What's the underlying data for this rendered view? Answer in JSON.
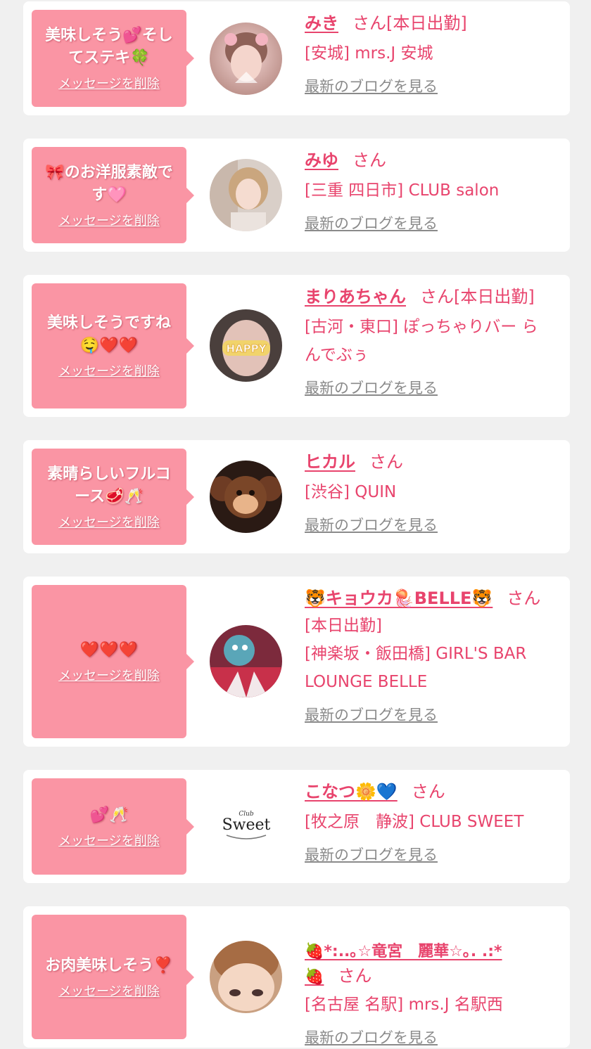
{
  "delete_label": "メッセージを削除",
  "blog_label": "最新のブログを見る",
  "cards": [
    {
      "message": "美味しそう💕そし\nてステキ🍀",
      "name": "みき",
      "suffix": "さん[本日出勤]",
      "shop_lines": [
        "[安城] mrs.J 安城"
      ],
      "avatar_icon": "girl-selfie-avatar"
    },
    {
      "message": "🎀のお洋服素敵で\nす🩷",
      "name": "みゆ",
      "suffix": "さん",
      "shop_lines": [
        "[三重 四日市] CLUB salon"
      ],
      "avatar_icon": "girl-selfie-avatar"
    },
    {
      "message": "美味しそうですね\n🤤❤️❤️",
      "name": "まりあちゃん",
      "suffix": "さん[本日出勤]",
      "shop_lines": [
        "[古河・東口] ぽっちゃりバー ら",
        "んでぶぅ"
      ],
      "avatar_icon": "happy-sticker-avatar"
    },
    {
      "message": "素晴らしいフルコ\nース🥩🥂",
      "name": "ヒカル",
      "suffix": "さん",
      "shop_lines": [
        "[渋谷] QUIN"
      ],
      "avatar_icon": "plush-toy-avatar"
    },
    {
      "message": "❤️❤️❤️",
      "name": "🐯キョウカ🪼BELLE🐯",
      "suffix": "さん",
      "shop_lines": [
        "[本日出勤]",
        "[神楽坂・飯田橋] GIRL'S BAR",
        "LOUNGE BELLE"
      ],
      "avatar_icon": "character-avatar"
    },
    {
      "message": "💕🥂",
      "name": "こなつ🌼💙",
      "suffix": "さん",
      "shop_lines": [
        "[牧之原　静波] CLUB SWEET"
      ],
      "avatar_icon": "club-sweet-logo-avatar",
      "logo_text": "Sweet",
      "logo_small": "Club"
    },
    {
      "message": "お肉美味しそう❣️",
      "name": "🍓*:..｡☆竜宮　麗華☆｡. .:*\n🍓",
      "suffix": "さん",
      "shop_lines": [
        "[名古屋 名駅] mrs.J 名駅西"
      ],
      "avatar_icon": "girl-closeup-avatar"
    }
  ],
  "colors": {
    "bubble": "#fa95a4",
    "accent": "#e8446d",
    "blog_link": "#8a8a8a",
    "background": "#f0f0f0"
  }
}
